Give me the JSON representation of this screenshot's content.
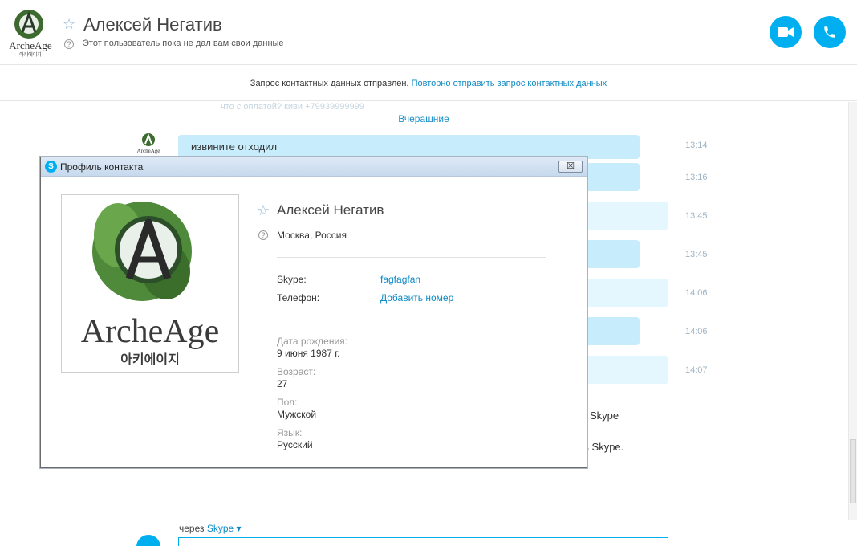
{
  "header": {
    "contact_name": "Алексей Негатив",
    "status_text": "Этот пользователь пока не дал вам свои данные",
    "buttons": {
      "video": "video-call",
      "phone": "audio-call"
    }
  },
  "infobar": {
    "text": "Запрос контактных данных отправлен.",
    "link": "Повторно отправить запрос контактных данных"
  },
  "chat": {
    "ghost_text": "что с оплатой? киви +79939999999",
    "day_separator": "Вчерашние",
    "messages": [
      {
        "text": "извините отходил",
        "time": "13:14"
      },
      {
        "text": "",
        "time": "13:16"
      },
      {
        "text": "",
        "time": "13:45"
      },
      {
        "text": "",
        "time": "13:45"
      },
      {
        "text": "",
        "time": "14:06"
      },
      {
        "text": "",
        "time": "14:06"
      },
      {
        "text": "",
        "time": "14:07"
      }
    ],
    "partial_1": "Skype",
    "partial_2": "в Skype.",
    "via_prefix": "через",
    "via_service": "Skype ▾"
  },
  "dialog": {
    "title": "Профиль контакта",
    "close_label": "☒",
    "name": "Алексей Негатив",
    "location": "Москва, Россия",
    "skype_label": "Skype:",
    "skype_value": "fagfagfan",
    "phone_label": "Телефон:",
    "phone_value": "Добавить номер",
    "birth_label": "Дата рождения:",
    "birth_value": "9 июня 1987 г.",
    "age_label": "Возраст:",
    "age_value": "27",
    "gender_label": "Пол:",
    "gender_value": "Мужской",
    "lang_label": "Язык:",
    "lang_value": "Русский"
  },
  "logo": {
    "main": "ArcheAge",
    "sub": "아키에이지"
  },
  "colors": {
    "accent": "#00aff0",
    "link": "#0d8ac4",
    "bubble": "#c7ecfc"
  }
}
